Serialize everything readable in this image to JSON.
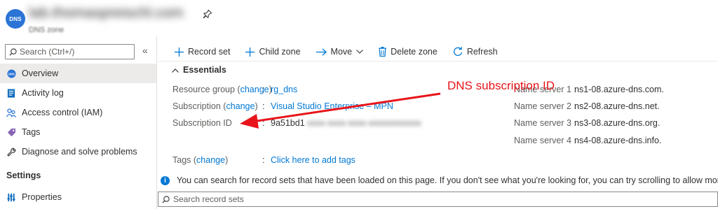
{
  "header": {
    "logo_text": "DNS",
    "resource_name": "lab.thomaspreischl.com",
    "resource_type": "DNS zone"
  },
  "sidebar": {
    "search_placeholder": "Search (Ctrl+/)",
    "collapse_glyph": "«",
    "items": [
      {
        "label": "Overview",
        "icon": "dns-zone-icon",
        "active": true
      },
      {
        "label": "Activity log",
        "icon": "activity-log-icon"
      },
      {
        "label": "Access control (IAM)",
        "icon": "people-icon"
      },
      {
        "label": "Tags",
        "icon": "tag-icon"
      },
      {
        "label": "Diagnose and solve problems",
        "icon": "wrench-icon"
      }
    ],
    "section_settings": "Settings",
    "settings_items": [
      {
        "label": "Properties",
        "icon": "properties-icon"
      }
    ]
  },
  "toolbar": {
    "record_set": "Record set",
    "child_zone": "Child zone",
    "move": "Move",
    "delete_zone": "Delete zone",
    "refresh": "Refresh"
  },
  "essentials": {
    "title": "Essentials",
    "resource_group_label": "Resource group",
    "change": "change",
    "resource_group_value": "rg_dns",
    "subscription_label": "Subscription",
    "subscription_value": "Visual Studio Enterprise – MPN",
    "subscription_id_label": "Subscription ID",
    "subscription_id_value": "9a51bd1",
    "subscription_id_hidden": "xxxx-xxxx-xxxx-xxxxxxxxxxxx",
    "tags_label": "Tags",
    "tags_value": "Click here to add tags",
    "name_servers": [
      {
        "label": "Name server 1",
        "value": "ns1-08.azure-dns.com."
      },
      {
        "label": "Name server 2",
        "value": "ns2-08.azure-dns.net."
      },
      {
        "label": "Name server 3",
        "value": "ns3-08.azure-dns.org."
      },
      {
        "label": "Name server 4",
        "value": "ns4-08.azure-dns.info."
      }
    ]
  },
  "annotation": {
    "text": "DNS subscription ID",
    "color": "#e8141a"
  },
  "info_message": "You can search for record sets that have been loaded on this page. If you don't see what you're looking for, you can try scrolling to allow more record sets",
  "record_search_placeholder": "Search record sets",
  "colors": {
    "accent": "#0078d4",
    "annotation": "#e8141a"
  }
}
